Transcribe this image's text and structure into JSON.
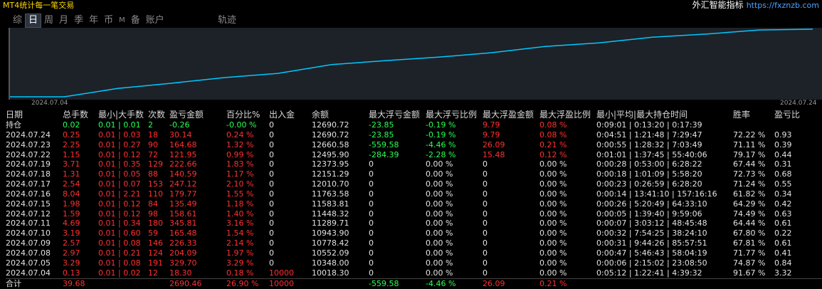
{
  "app_title": "MT4统计每一笔交易",
  "brand": {
    "name": "外汇智能指标",
    "url": "https://fxznzb.com"
  },
  "tabs": [
    {
      "label": "综",
      "active": false,
      "small": false
    },
    {
      "label": "日",
      "active": true,
      "small": false
    },
    {
      "label": "周",
      "active": false,
      "small": false
    },
    {
      "label": "月",
      "active": false,
      "small": false
    },
    {
      "label": "季",
      "active": false,
      "small": false
    },
    {
      "label": "年",
      "active": false,
      "small": false
    },
    {
      "label": "币",
      "active": false,
      "small": false
    },
    {
      "label": "M",
      "active": false,
      "small": true
    },
    {
      "label": "备",
      "active": false,
      "small": false
    },
    {
      "label": "账户",
      "active": false,
      "small": false
    }
  ],
  "tab_track": "轨迹",
  "chart_data": {
    "type": "line",
    "x_start_label": "2024.07.04",
    "x_end_label": "2024.07.24",
    "x": [
      "2024.07.04",
      "2024.07.05",
      "2024.07.08",
      "2024.07.09",
      "2024.07.10",
      "2024.07.11",
      "2024.07.12",
      "2024.07.15",
      "2024.07.16",
      "2024.07.17",
      "2024.07.18",
      "2024.07.19",
      "2024.07.22",
      "2024.07.23",
      "2024.07.24"
    ],
    "values": [
      10018.3,
      10348.0,
      10552.09,
      10778.42,
      10943.9,
      11289.71,
      11448.32,
      11583.81,
      11763.58,
      12010.7,
      12151.29,
      12373.95,
      12495.9,
      12660.58,
      12690.72
    ],
    "color": "#00c8ff"
  },
  "colors": {
    "positive": "#ff3030",
    "negative": "#2bff55",
    "neutral": "#e2e2e2",
    "accent": "#00c8ff"
  },
  "table": {
    "headers": {
      "date": "日期",
      "total": "总手数",
      "lots": "最小|大手数",
      "count": "次数",
      "profit": "盈亏金额",
      "pct": "百分比%",
      "io": "出入金",
      "bal": "余额",
      "fl": "最大浮亏金额",
      "flp": "最大浮亏比例",
      "fp": "最大浮盈金额",
      "fpp": "最大浮盈比例",
      "time": "最小|平均|最大持仓时间",
      "win": "胜率",
      "ratio": "盈亏比"
    },
    "position": {
      "date": "持仓",
      "total": "0.02",
      "lots": "0.01 | 0.01",
      "count": "2",
      "profit": "-0.26",
      "pct": "-0.00 %",
      "io": "0",
      "bal": "12690.72",
      "fl": "-23.85",
      "flp": "-0.19 %",
      "fp": "9.79",
      "fpp": "0.08 %",
      "time": "0:09:01 | 0:13:20 | 0:17:39",
      "win": "",
      "ratio": ""
    },
    "rows": [
      {
        "date": "2024.07.24",
        "total": "0.25",
        "lots": "0.01 | 0.03",
        "count": "18",
        "profit": "30.14",
        "pct": "0.24 %",
        "io": "0",
        "bal": "12690.72",
        "fl": "-23.85",
        "flp": "-0.19 %",
        "fp": "9.79",
        "fpp": "0.08 %",
        "time": "0:04:51 | 1:21:48 | 7:29:47",
        "win": "72.22 %",
        "ratio": "0.93",
        "fl_neg": true
      },
      {
        "date": "2024.07.23",
        "total": "2.25",
        "lots": "0.01 | 0.27",
        "count": "90",
        "profit": "164.68",
        "pct": "1.32 %",
        "io": "0",
        "bal": "12660.58",
        "fl": "-559.58",
        "flp": "-4.46 %",
        "fp": "26.09",
        "fpp": "0.21 %",
        "time": "0:00:55 | 1:28:32 | 7:03:49",
        "win": "71.11 %",
        "ratio": "0.39",
        "fl_neg": true
      },
      {
        "date": "2024.07.22",
        "total": "1.15",
        "lots": "0.01 | 0.12",
        "count": "72",
        "profit": "121.95",
        "pct": "0.99 %",
        "io": "0",
        "bal": "12495.90",
        "fl": "-284.39",
        "flp": "-2.28 %",
        "fp": "15.48",
        "fpp": "0.12 %",
        "time": "0:01:01 | 1:37:45 | 55:40:06",
        "win": "79.17 %",
        "ratio": "0.44",
        "fl_neg": true
      },
      {
        "date": "2024.07.19",
        "total": "3.71",
        "lots": "0.01 | 0.35",
        "count": "129",
        "profit": "222.66",
        "pct": "1.83 %",
        "io": "0",
        "bal": "12373.95",
        "fl": "0",
        "flp": "0.00 %",
        "fp": "0",
        "fpp": "0.00 %",
        "time": "0:00:28 | 0:53:00 | 6:28:22",
        "win": "67.44 %",
        "ratio": "0.31",
        "fl_neg": false
      },
      {
        "date": "2024.07.18",
        "total": "1.31",
        "lots": "0.01 | 0.05",
        "count": "88",
        "profit": "140.59",
        "pct": "1.17 %",
        "io": "0",
        "bal": "12151.29",
        "fl": "0",
        "flp": "0.00 %",
        "fp": "0",
        "fpp": "0.00 %",
        "time": "0:00:18 | 1:01:09 | 5:58:20",
        "win": "72.73 %",
        "ratio": "0.68",
        "fl_neg": false
      },
      {
        "date": "2024.07.17",
        "total": "2.54",
        "lots": "0.01 | 0.07",
        "count": "153",
        "profit": "247.12",
        "pct": "2.10 %",
        "io": "0",
        "bal": "12010.70",
        "fl": "0",
        "flp": "0.00 %",
        "fp": "0",
        "fpp": "0.00 %",
        "time": "0:00:23 | 0:26:59 | 6:28:20",
        "win": "71.24 %",
        "ratio": "0.55",
        "fl_neg": false
      },
      {
        "date": "2024.07.16",
        "total": "8.04",
        "lots": "0.01 | 2.21",
        "count": "110",
        "profit": "179.77",
        "pct": "1.55 %",
        "io": "0",
        "bal": "11763.58",
        "fl": "0",
        "flp": "0.00 %",
        "fp": "0",
        "fpp": "0.00 %",
        "time": "0:00:14 | 13:41:10 | 157:16:16",
        "win": "61.82 %",
        "ratio": "0.34",
        "fl_neg": false
      },
      {
        "date": "2024.07.15",
        "total": "1.98",
        "lots": "0.01 | 0.12",
        "count": "84",
        "profit": "135.49",
        "pct": "1.18 %",
        "io": "0",
        "bal": "11583.81",
        "fl": "0",
        "flp": "0.00 %",
        "fp": "0",
        "fpp": "0.00 %",
        "time": "0:00:26 | 5:20:49 | 64:33:10",
        "win": "64.29 %",
        "ratio": "0.42",
        "fl_neg": false
      },
      {
        "date": "2024.07.12",
        "total": "1.59",
        "lots": "0.01 | 0.12",
        "count": "98",
        "profit": "158.61",
        "pct": "1.40 %",
        "io": "0",
        "bal": "11448.32",
        "fl": "0",
        "flp": "0.00 %",
        "fp": "0",
        "fpp": "0.00 %",
        "time": "0:00:05 | 1:39:40 | 9:59:06",
        "win": "74.49 %",
        "ratio": "0.63",
        "fl_neg": false
      },
      {
        "date": "2024.07.11",
        "total": "4.69",
        "lots": "0.01 | 0.34",
        "count": "180",
        "profit": "345.81",
        "pct": "3.16 %",
        "io": "0",
        "bal": "11289.71",
        "fl": "0",
        "flp": "0.00 %",
        "fp": "0",
        "fpp": "0.00 %",
        "time": "0:00:07 | 3:03:12 | 48:45:48",
        "win": "64.44 %",
        "ratio": "0.61",
        "fl_neg": false
      },
      {
        "date": "2024.07.10",
        "total": "3.19",
        "lots": "0.01 | 0.60",
        "count": "59",
        "profit": "165.48",
        "pct": "1.54 %",
        "io": "0",
        "bal": "10943.90",
        "fl": "0",
        "flp": "0.00 %",
        "fp": "0",
        "fpp": "0.00 %",
        "time": "0:00:32 | 7:54:25 | 38:24:10",
        "win": "67.80 %",
        "ratio": "0.22",
        "fl_neg": false
      },
      {
        "date": "2024.07.09",
        "total": "2.57",
        "lots": "0.01 | 0.08",
        "count": "146",
        "profit": "226.33",
        "pct": "2.14 %",
        "io": "0",
        "bal": "10778.42",
        "fl": "0",
        "flp": "0.00 %",
        "fp": "0",
        "fpp": "0.00 %",
        "time": "0:00:31 | 9:44:26 | 85:57:51",
        "win": "67.81 %",
        "ratio": "0.61",
        "fl_neg": false
      },
      {
        "date": "2024.07.08",
        "total": "2.97",
        "lots": "0.01 | 0.21",
        "count": "124",
        "profit": "204.09",
        "pct": "1.97 %",
        "io": "0",
        "bal": "10552.09",
        "fl": "0",
        "flp": "0.00 %",
        "fp": "0",
        "fpp": "0.00 %",
        "time": "0:00:47 | 5:46:43 | 58:04:19",
        "win": "71.77 %",
        "ratio": "0.41",
        "fl_neg": false
      },
      {
        "date": "2024.07.05",
        "total": "3.29",
        "lots": "0.01 | 0.08",
        "count": "191",
        "profit": "329.70",
        "pct": "3.29 %",
        "io": "0",
        "bal": "10348.00",
        "fl": "0",
        "flp": "0.00 %",
        "fp": "0",
        "fpp": "0.00 %",
        "time": "0:00:06 | 2:15:02 | 23:08:50",
        "win": "74.87 %",
        "ratio": "0.84",
        "fl_neg": false
      },
      {
        "date": "2024.07.04",
        "total": "0.13",
        "lots": "0.01 | 0.02",
        "count": "12",
        "profit": "18.30",
        "pct": "0.18 %",
        "io": "10000",
        "bal": "10018.30",
        "fl": "0",
        "flp": "0.00 %",
        "fp": "0",
        "fpp": "0.00 %",
        "time": "0:05:12 | 1:22:41 | 4:39:32",
        "win": "91.67 %",
        "ratio": "3.32",
        "fl_neg": false
      }
    ],
    "totals": {
      "date": "合计",
      "total": "39.68",
      "profit": "2690.46",
      "pct": "26.90 %",
      "io": "10000",
      "fl": "-559.58",
      "flp": "-4.46 %",
      "fp": "26.09",
      "fpp": "0.21 %"
    }
  }
}
